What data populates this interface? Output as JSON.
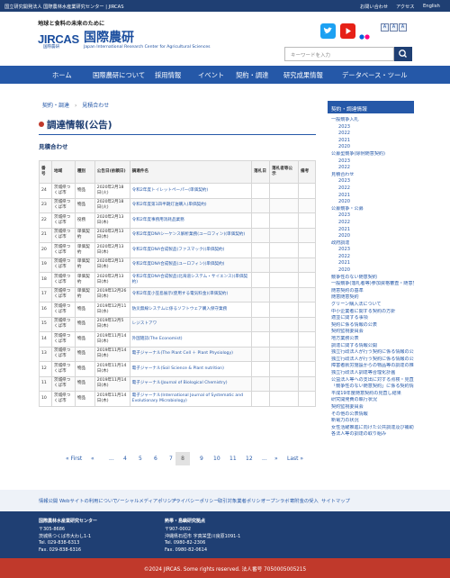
{
  "topbar": {
    "org": "国立研究開発法人 国際農林水産業研究センター | JIRCAS",
    "links": [
      "お問い合わせ",
      "アクセス",
      "English"
    ]
  },
  "header": {
    "tagline": "地球と食料の未来のために",
    "logo_text": "JIRCAS",
    "logo_sub": "国際農研",
    "brand_jp": "国際農研",
    "brand_en": "Japan International Research Center for Agricultural Sciences",
    "search_placeholder": "キーワードを入力",
    "font_sizes": [
      "A",
      "A",
      "A"
    ]
  },
  "nav": [
    "ホーム",
    "国際農研について",
    "採用情報",
    "イベント",
    "契約・調達",
    "研究成果情報",
    "データベース・ツール"
  ],
  "breadcrumb": {
    "parent": "契約・調達",
    "sep": "›",
    "current": "見積合わせ"
  },
  "page_title": "調達情報(公告)",
  "section_title": "見積合わせ",
  "table": {
    "headers": [
      "番号",
      "地域",
      "種別",
      "公告日(依頼日)",
      "調達件名",
      "落札日",
      "落札者等公示",
      "備考"
    ],
    "rows": [
      [
        "24",
        "茨城県つくば市",
        "物品",
        "2020年2月18日(火)",
        "令和2年度トイレットペーパー(単価契約)",
        "",
        "",
        ""
      ],
      [
        "23",
        "茨城県つくば市",
        "物品",
        "2020年2月18日(火)",
        "令和2年度第1四半期灯油購入(単価契約)",
        "",
        "",
        ""
      ],
      [
        "22",
        "茨城県つくば市",
        "役務",
        "2020年2月13日(木)",
        "令和2年度事務用消耗品業務",
        "",
        "",
        ""
      ],
      [
        "21",
        "茨城県つくば市",
        "単価契約",
        "2020年2月13日(木)",
        "令和2年度DNAシーケンス解析業務(ユーロフィン)(単価契約)",
        "",
        "",
        ""
      ],
      [
        "20",
        "茨城県つくば市",
        "単価契約",
        "2020年2月13日(木)",
        "令和2年度DNA合成製品(ファスマック)(単価契約)",
        "",
        "",
        ""
      ],
      [
        "19",
        "茨城県つくば市",
        "単価契約",
        "2020年2月13日(木)",
        "令和2年度DNA合成製品(ユーロフィン)(単価契約)",
        "",
        "",
        ""
      ],
      [
        "18",
        "茨城県つくば市",
        "単価契約",
        "2020年2月13日(木)",
        "令和2年度DNA合成製品(北海道システム・サイエンス)(単価契約)",
        "",
        "",
        ""
      ],
      [
        "17",
        "茨城県つくば市",
        "単価契約",
        "2019年12月26日(木)",
        "令和2年度小笠島展示(使用する電気料金)(単価契約)",
        "",
        "",
        ""
      ],
      [
        "16",
        "茨城県つくば市",
        "物品",
        "2019年12月11日(水)",
        "防災無線システムに係るソフトウェア購入保守業務",
        "",
        "",
        ""
      ],
      [
        "15",
        "茨城県つくば市",
        "物品",
        "2019年12月5日(木)",
        "レジストアワ",
        "",
        "",
        ""
      ],
      [
        "14",
        "茨城県つくば市",
        "物品",
        "2019年11月14日(木)",
        "外国雑誌(The Economist)",
        "",
        "",
        ""
      ],
      [
        "13",
        "茨城県つくば市",
        "物品",
        "2019年11月14日(木)",
        "電子ジャーナル(The Plant Cell ＋ Plant Physiology)",
        "",
        "",
        ""
      ],
      [
        "12",
        "茨城県つくば市",
        "物品",
        "2019年11月14日(木)",
        "電子ジャーナル(Soil Science & Plant nutrition)",
        "",
        "",
        ""
      ],
      [
        "11",
        "茨城県つくば市",
        "物品",
        "2019年11月14日(木)",
        "電子ジャーナル(Journal of Biological Chemistry)",
        "",
        "",
        ""
      ],
      [
        "10",
        "茨城県つくば市",
        "物品",
        "2019年11月14日(木)",
        "電子ジャーナル(International Journal of Systematic and Evolutionary Microbiology)",
        "",
        "",
        ""
      ]
    ]
  },
  "pager": {
    "items": [
      "« First",
      "«",
      "...",
      "4",
      "5",
      "6",
      "7",
      "8",
      "9",
      "10",
      "11",
      "12",
      "...",
      "»",
      "Last »"
    ],
    "current": "8"
  },
  "sidebar": {
    "title": "契約・調達情報",
    "items": [
      "一般競争入札",
      "2023",
      "2022",
      "2021",
      "2020",
      "公募型競争(除例随意契約)",
      "2023",
      "2022",
      "見積合わせ",
      "2023",
      "2022",
      "2021",
      "2020",
      "公募競争・公募",
      "2023",
      "2022",
      "2021",
      "2020",
      "政府調達",
      "2023",
      "2022",
      "2021",
      "2020",
      "競争性のない随意契約",
      "一般競争(落札者等)参加資格審査・随意契約の見直し",
      "随意契約の基準",
      "随意随意契約",
      "グリーン購入法について",
      "中小企業者に関する契約の方針",
      "適並に関する事項",
      "契約に係る情報の公表",
      "契約監視委員会",
      "地方業務公表",
      "調達に関する情報公開",
      "独立行政法人が行う契約に係る情報の公表",
      "独立行政法人が行う契約に係る情報の公表",
      "障害者就労施設からの物品等の調達の推進を図るための方針",
      "独立行政法人調達等合理化計画",
      "公益法人等への支出に対する点検・見直し状況",
      "「競争性のない随意契約」に係る契約情報の公表",
      "平成19年度随意契約の見直し結果",
      "研究開発費の執行状況",
      "契約監視委員会",
      "その他の公表情報",
      "新電力の状況",
      "女性活躍推進に向けた公共調達及び補助金の活用に関する取組",
      "各法人等の調達の取り組み"
    ]
  },
  "footer_links": [
    "情報公開",
    "Webサイトの利用について",
    "ソーシャルメディアポリシー",
    "プライバシーポリシー",
    "取引対象業者ポリシー",
    "オープンラボ",
    "寄附金の受入",
    "サイトマップ"
  ],
  "footer": {
    "left": {
      "name": "国際農林水産業研究センター",
      "zip": "〒305-8686",
      "addr": "茨城県つくば市大わし1-1",
      "tel": "Tel. 029-838-6313",
      "fax": "Fax. 029-838-6316"
    },
    "right": {
      "name": "熱帯・島嶼研究拠点",
      "zip": "〒907-0002",
      "addr": "沖縄県石垣市 字真栄里川良原1091-1",
      "tel": "Tel. 0980-82-2306",
      "fax": "Fax. 0980-82-0614"
    }
  },
  "copyright": "©2024 JIRCAS. Some rights reserved. 法人番号 7050005005215",
  "colors": {
    "primary": "#2558a8",
    "dark": "#1f3f73",
    "accent": "#c0392b"
  }
}
